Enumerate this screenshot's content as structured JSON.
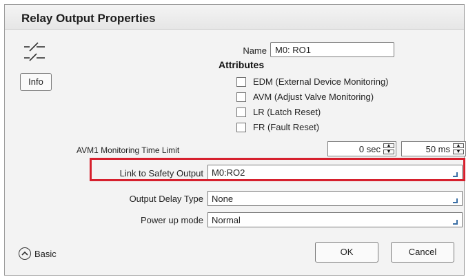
{
  "title": "Relay Output Properties",
  "info_label": "Info",
  "name": {
    "label": "Name",
    "value": "M0: RO1"
  },
  "attributes": {
    "heading": "Attributes",
    "items": [
      {
        "label": "EDM (External Device Monitoring)",
        "checked": false
      },
      {
        "label": "AVM (Adjust Valve Monitoring)",
        "checked": false
      },
      {
        "label": "LR (Latch Reset)",
        "checked": false
      },
      {
        "label": "FR (Fault Reset)",
        "checked": false
      }
    ]
  },
  "avm_time": {
    "label": "AVM1 Monitoring Time Limit",
    "sec": "0 sec",
    "ms": "50 ms"
  },
  "link_to_safety_output": {
    "label": "Link to Safety Output",
    "value": "M0:RO2"
  },
  "output_delay_type": {
    "label": "Output Delay Type",
    "value": "None"
  },
  "power_up_mode": {
    "label": "Power up mode",
    "value": "Normal"
  },
  "basic_label": "Basic",
  "ok_label": "OK",
  "cancel_label": "Cancel",
  "colors": {
    "highlight": "#d6202d",
    "dropdown_arrow": "#3a6ea5"
  }
}
